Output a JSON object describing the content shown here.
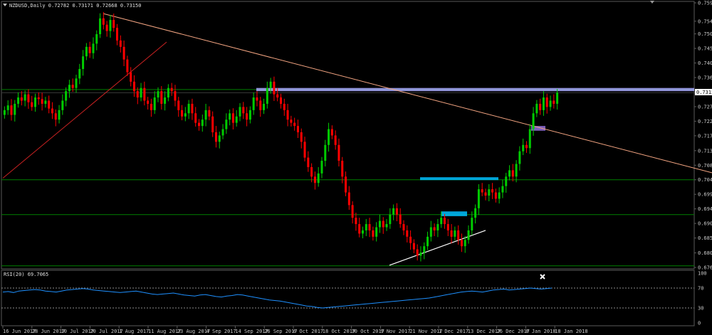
{
  "header": {
    "symbol_line": "NZDUSD,Daily 0.72782 0.73171 0.72668 0.73150"
  },
  "rsi_panel": {
    "label": "RSI(20) 69.7065",
    "scale": [
      "100",
      "70",
      "30",
      "0"
    ]
  },
  "colors": {
    "background": "#000000",
    "bull_candle": "#00cc00",
    "bear_candle": "#ff0000",
    "support_line": "#008000",
    "trendline": "#f4a582",
    "zone_blue": "#a9a9ff",
    "zone_cyan": "#00bfff",
    "zone_purple": "#9370db",
    "rsi_line": "#1e90ff",
    "ask_line": "#ffffff"
  },
  "icons": {
    "header_dropdown": "triangle-down-icon",
    "rsi_close": "close-x-icon",
    "scroll_marker": "triangle-down-icon"
  },
  "chart_data": {
    "type": "candlestick",
    "symbol": "NZDUSD",
    "timeframe": "Daily",
    "ohlc_last": {
      "open": 0.72782,
      "high": 0.73171,
      "low": 0.72668,
      "close": 0.7315
    },
    "price_axis_labels": [
      "0.75990",
      "0.75410",
      "0.75010",
      "0.74550",
      "0.74090",
      "0.73630",
      "0.73150",
      "0.72710",
      "0.72250",
      "0.71790",
      "0.71320",
      "0.70860",
      "0.70400",
      "0.69940",
      "0.69480",
      "0.69020",
      "0.68560",
      "0.68090",
      "0.67630"
    ],
    "current_price_label": "0.73150",
    "ylim": [
      0.6763,
      0.7599
    ],
    "date_axis_labels": [
      "16 Jun 2017",
      "28 Jun 2017",
      "10 Jul 2017",
      "20 Jul 2017",
      "1 Aug 2017",
      "11 Aug 2017",
      "23 Aug 2017",
      "4 Sep 2017",
      "14 Sep 2017",
      "26 Sep 2017",
      "6 Oct 2017",
      "18 Oct 2017",
      "30 Oct 2017",
      "9 Nov 2017",
      "21 Nov 2017",
      "1 Dec 2017",
      "13 Dec 2017",
      "26 Dec 2017",
      "8 Jan 2018",
      "18 Jan 2018"
    ],
    "closes": [
      0.726,
      0.7275,
      0.7245,
      0.728,
      0.73,
      0.729,
      0.731,
      0.7285,
      0.727,
      0.73,
      0.7295,
      0.728,
      0.729,
      0.7265,
      0.725,
      0.723,
      0.726,
      0.729,
      0.732,
      0.734,
      0.733,
      0.736,
      0.739,
      0.743,
      0.746,
      0.744,
      0.747,
      0.75,
      0.755,
      0.753,
      0.751,
      0.7545,
      0.752,
      0.748,
      0.746,
      0.742,
      0.738,
      0.735,
      0.732,
      0.73,
      0.733,
      0.729,
      0.728,
      0.726,
      0.73,
      0.732,
      0.728,
      0.73,
      0.733,
      0.732,
      0.729,
      0.726,
      0.724,
      0.725,
      0.728,
      0.725,
      0.722,
      0.721,
      0.723,
      0.726,
      0.724,
      0.719,
      0.716,
      0.718,
      0.72,
      0.723,
      0.725,
      0.722,
      0.724,
      0.727,
      0.725,
      0.723,
      0.726,
      0.73,
      0.729,
      0.726,
      0.728,
      0.733,
      0.735,
      0.731,
      0.73,
      0.728,
      0.726,
      0.723,
      0.722,
      0.721,
      0.719,
      0.716,
      0.711,
      0.708,
      0.705,
      0.703,
      0.706,
      0.71,
      0.715,
      0.72,
      0.718,
      0.715,
      0.71,
      0.705,
      0.7,
      0.696,
      0.692,
      0.69,
      0.687,
      0.688,
      0.69,
      0.688,
      0.686,
      0.689,
      0.691,
      0.689,
      0.69,
      0.693,
      0.695,
      0.693,
      0.69,
      0.688,
      0.686,
      0.684,
      0.682,
      0.68,
      0.681,
      0.683,
      0.686,
      0.689,
      0.688,
      0.69,
      0.692,
      0.69,
      0.688,
      0.686,
      0.688,
      0.685,
      0.683,
      0.685,
      0.688,
      0.692,
      0.695,
      0.701,
      0.7,
      0.699,
      0.701,
      0.7,
      0.698,
      0.7,
      0.702,
      0.705,
      0.707,
      0.705,
      0.709,
      0.713,
      0.715,
      0.714,
      0.72,
      0.725,
      0.728,
      0.726,
      0.73,
      0.727,
      0.729,
      0.728,
      0.7315
    ],
    "horizontal_levels": [
      0.7325,
      0.704,
      0.693,
      0.6768
    ],
    "zones": [
      {
        "name": "upper-resistance-zone",
        "price_from": 0.732,
        "price_to": 0.733
      },
      {
        "name": "trendline-break-zone",
        "price_from": 0.7195,
        "price_to": 0.721
      },
      {
        "name": "mid-support-zone",
        "price_from": 0.704,
        "price_to": 0.7048
      },
      {
        "name": "lower-support-zone",
        "price_from": 0.6925,
        "price_to": 0.694
      }
    ],
    "rsi": {
      "name": "RSI(20)",
      "last": 69.7065,
      "ylim": [
        0,
        100
      ],
      "levels": [
        70,
        30
      ],
      "values": [
        62,
        63,
        61,
        64,
        65,
        66,
        67,
        66,
        64,
        63,
        62,
        64,
        66,
        67,
        68,
        69,
        68,
        66,
        65,
        64,
        63,
        62,
        61,
        62,
        63,
        64,
        62,
        60,
        58,
        57,
        58,
        59,
        60,
        58,
        56,
        55,
        54,
        56,
        57,
        55,
        53,
        52,
        54,
        55,
        57,
        56,
        54,
        52,
        50,
        48,
        46,
        45,
        44,
        42,
        40,
        38,
        36,
        34,
        33,
        31,
        30,
        31,
        32,
        33,
        34,
        35,
        36,
        37,
        38,
        39,
        40,
        41,
        42,
        43,
        44,
        45,
        46,
        47,
        48,
        49,
        50,
        52,
        54,
        56,
        58,
        60,
        62,
        63,
        64,
        63,
        62,
        64,
        66,
        67,
        68,
        66,
        67,
        68,
        69,
        70,
        69,
        68,
        69,
        70
      ]
    }
  }
}
